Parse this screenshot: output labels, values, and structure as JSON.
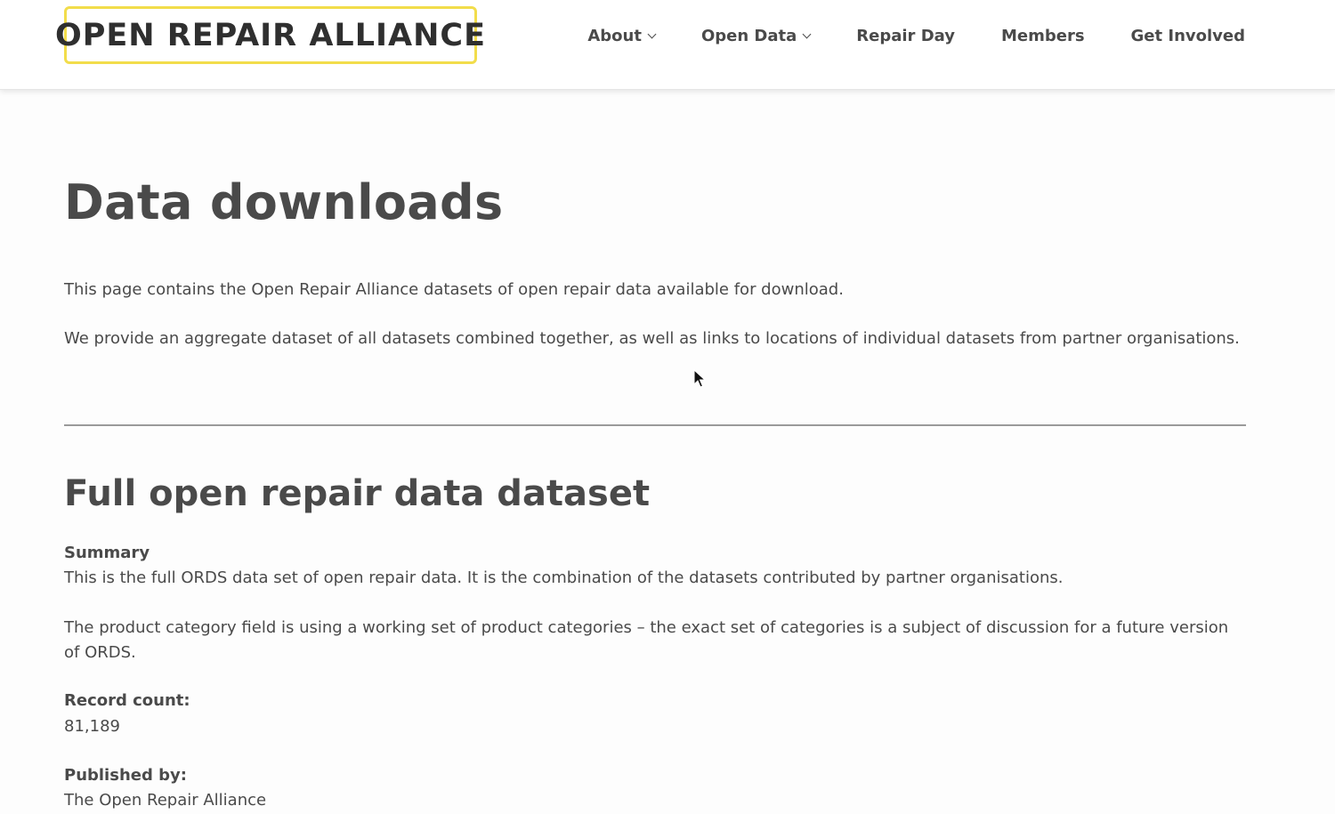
{
  "logo": {
    "text": "OPEN REPAIR ALLIANCE",
    "border_color": "#f2dd4b"
  },
  "nav": {
    "items": [
      {
        "label": "About",
        "has_dropdown": true
      },
      {
        "label": "Open Data",
        "has_dropdown": true
      },
      {
        "label": "Repair Day",
        "has_dropdown": false
      },
      {
        "label": "Members",
        "has_dropdown": false
      },
      {
        "label": "Get Involved",
        "has_dropdown": false
      }
    ]
  },
  "page": {
    "title": "Data downloads",
    "intro": "This page contains the Open Repair Alliance datasets of open repair data available for download.",
    "intro2": "We provide an aggregate dataset of all datasets combined together, as well as links to locations of individual datasets from partner organisations."
  },
  "dataset": {
    "heading": "Full open repair data dataset",
    "summary_label": "Summary",
    "summary_text": "This is the full ORDS data set of open repair data. It is the combination of the datasets contributed by partner organisations.",
    "category_note": "The product category field is using a working set of product categories – the exact set of categories is a subject of discussion for a future version of ORDS.",
    "record_count_label": "Record count:",
    "record_count_value": "81,189",
    "published_by_label": "Published by:",
    "published_by_value": "The Open Repair Alliance"
  },
  "colors": {
    "text": "#4a4a4a",
    "accent": "#f2dd4b",
    "divider": "#9a9a9a"
  }
}
